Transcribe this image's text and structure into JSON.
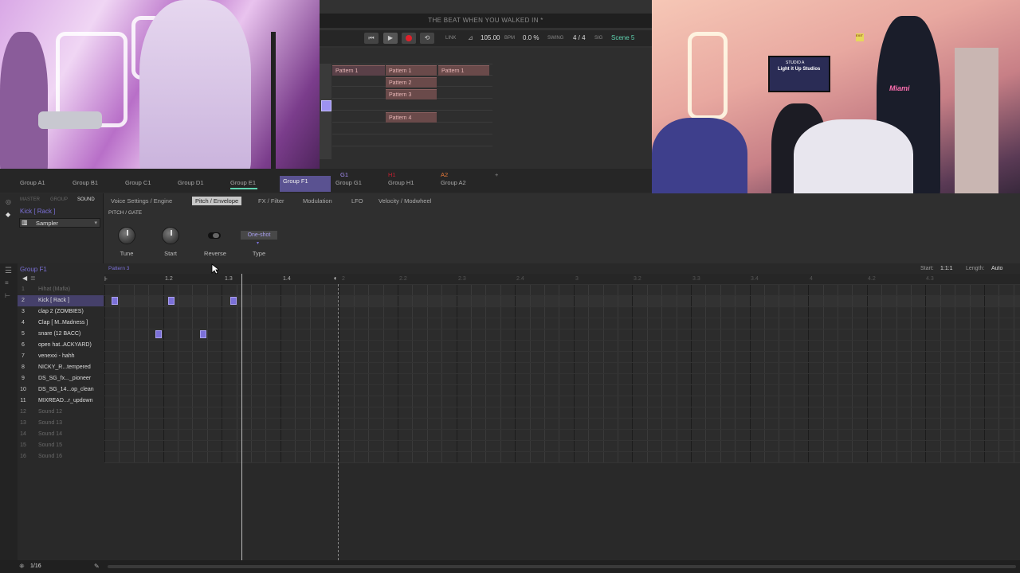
{
  "project_title": "THE BEAT WHEN YOU WALKED IN *",
  "transport": {
    "link": "LINK",
    "tempo": "105.00",
    "tempo_unit": "BPM",
    "swing": "0.0 %",
    "swing_label": "SWING",
    "signature": "4 / 4",
    "signature_label": "SIG",
    "scene": "Scene 5"
  },
  "arranger": {
    "patterns": [
      {
        "label": "Pattern 1"
      },
      {
        "label": "Pattern 1"
      },
      {
        "label": "Pattern 2"
      },
      {
        "label": "Pattern 3"
      },
      {
        "label": "Pattern 4"
      },
      {
        "label": "Pattern 1"
      }
    ]
  },
  "groups": {
    "tabs": [
      "Group A1",
      "Group B1",
      "Group C1",
      "Group D1",
      "Group E1",
      "Group F1"
    ],
    "selected": "Group F1",
    "extra": [
      {
        "code": "G1",
        "label": "Group G1"
      },
      {
        "code": "H1",
        "label": "Group H1"
      },
      {
        "code": "A2",
        "label": "Group A2"
      }
    ],
    "add": "+"
  },
  "plugin": {
    "modes": [
      "MASTER",
      "GROUP",
      "SOUND"
    ],
    "sound_name": "Kick [ Rack ]",
    "instrument": "Sampler",
    "tabs": [
      "Voice Settings / Engine",
      "Pitch / Envelope",
      "FX / Filter",
      "Modulation",
      "LFO",
      "Velocity / Modwheel"
    ],
    "active_tab": "Pitch / Envelope",
    "section": "PITCH / GATE",
    "controls": {
      "tune": "Tune",
      "start": "Start",
      "reverse": "Reverse",
      "type": "Type",
      "type_value": "One-shot"
    }
  },
  "editor": {
    "group_name": "Group F1",
    "pattern_name": "Pattern 3",
    "ruler": [
      "1.2",
      "1.3",
      "1.4",
      "2",
      "2.2",
      "2.3",
      "2.4",
      "3",
      "3.2",
      "3.3",
      "3.4",
      "4",
      "4.2",
      "4.3"
    ],
    "start_label": "Start:",
    "start_value": "1:1:1",
    "length_label": "Length:",
    "length_value": "Auto",
    "grid": "1/16",
    "tracks": [
      {
        "num": "1",
        "name": "Hihat (Mafia)",
        "dim": true
      },
      {
        "num": "2",
        "name": "Kick [ Rack ]",
        "selected": true
      },
      {
        "num": "3",
        "name": "clap 2 (ZOMBIES)"
      },
      {
        "num": "4",
        "name": "Clap [ M..Madness ]"
      },
      {
        "num": "5",
        "name": "snare (12 BACC)"
      },
      {
        "num": "6",
        "name": "open hat..ACKYARD)"
      },
      {
        "num": "7",
        "name": "venexxi - hahh"
      },
      {
        "num": "8",
        "name": "NICKY_R...tempered"
      },
      {
        "num": "9",
        "name": "DS_SG_fx..._pioneer"
      },
      {
        "num": "10",
        "name": "DS_SG_14...op_clean"
      },
      {
        "num": "11",
        "name": "MIXREAD...r_updown"
      },
      {
        "num": "12",
        "name": "Sound 12",
        "dim": true
      },
      {
        "num": "13",
        "name": "Sound 13",
        "dim": true
      },
      {
        "num": "14",
        "name": "Sound 14",
        "dim": true
      },
      {
        "num": "15",
        "name": "Sound 15",
        "dim": true
      },
      {
        "num": "16",
        "name": "Sound 16",
        "dim": true
      }
    ]
  },
  "overlay": {
    "tv_text_1": "STUDIO A",
    "tv_text_2": "Light it Up Studios",
    "jersey_text": "Miami",
    "sign_text": "EXIT"
  }
}
